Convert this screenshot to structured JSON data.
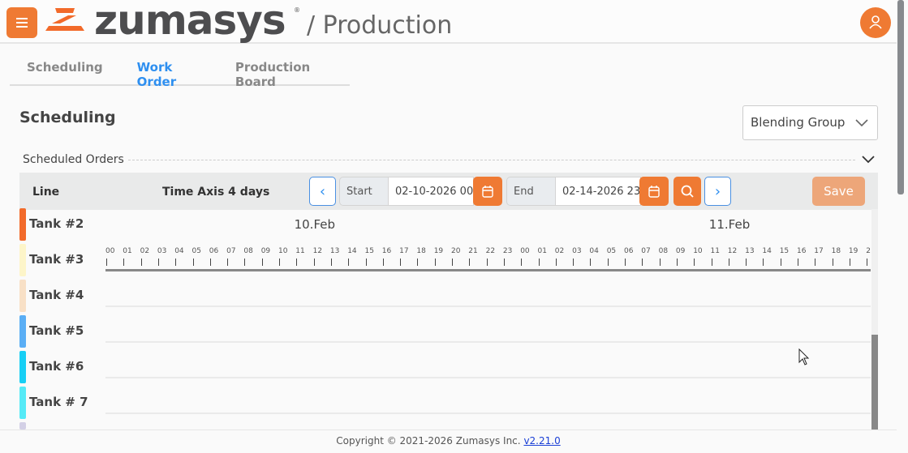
{
  "header": {
    "brand": "zumasys",
    "title": "/ Production",
    "menu_icon": "hamburger-icon",
    "user_icon": "user-icon",
    "accent": "#ef7a33"
  },
  "tabs": [
    {
      "label": "Scheduling"
    },
    {
      "label": "Work Order",
      "active": true
    },
    {
      "label": "Production Board"
    }
  ],
  "page": {
    "heading": "Scheduling",
    "group_select": "Blending Group",
    "section_title": "Scheduled Orders"
  },
  "toolbar": {
    "line_label": "Line",
    "time_axis_label": "Time Axis 4 days",
    "start_label": "Start",
    "start_value": "02-10-2026 00",
    "end_label": "End",
    "end_value": "02-14-2026 23",
    "save_label": "Save"
  },
  "rows": [
    {
      "label": "Tank #2",
      "color": "#f26a2a"
    },
    {
      "label": "Tank #3",
      "color": "#fdf5c9"
    },
    {
      "label": "Tank #4",
      "color": "#f8e0c6"
    },
    {
      "label": "Tank #5",
      "color": "#5aaef5"
    },
    {
      "label": "Tank #6",
      "color": "#17cff5"
    },
    {
      "label": "Tank # 7",
      "color": "#55eaf7"
    },
    {
      "label": "",
      "color": "#d3d0e6"
    }
  ],
  "timeline": {
    "days": [
      "10.Feb",
      "11.Feb"
    ],
    "hours": [
      "00",
      "01",
      "02",
      "03",
      "04",
      "05",
      "06",
      "07",
      "08",
      "09",
      "10",
      "11",
      "12",
      "13",
      "14",
      "15",
      "16",
      "17",
      "18",
      "19",
      "20",
      "21",
      "22",
      "23"
    ]
  },
  "footer": {
    "copyright": "Copyright © 2021-2026 Zumasys Inc.",
    "version": "v2.21.0"
  }
}
